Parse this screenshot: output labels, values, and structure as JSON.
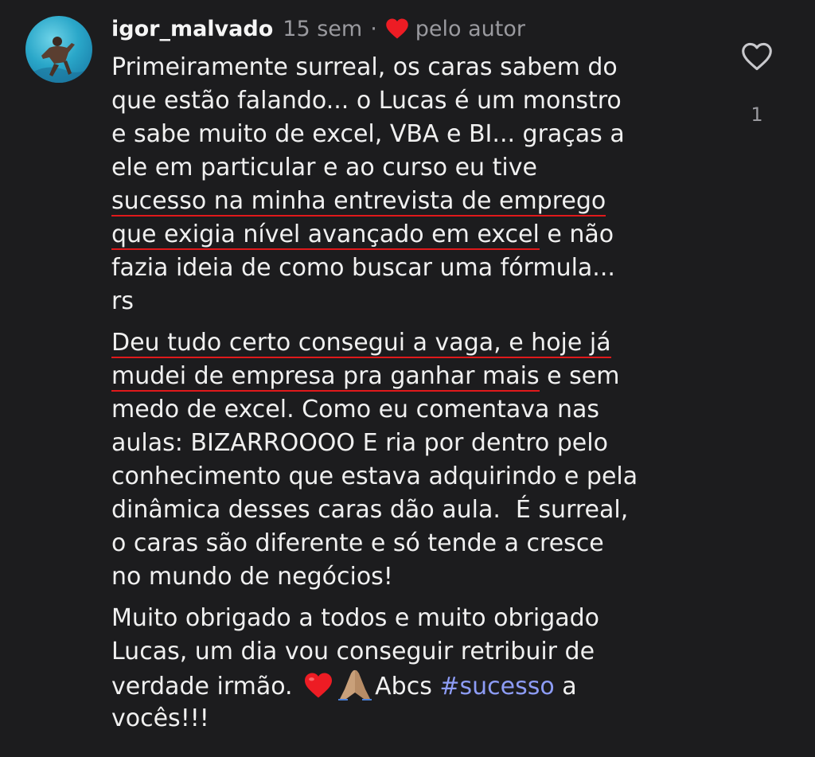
{
  "comment": {
    "username": "igor_malvado",
    "time": "15 sem",
    "separator": "·",
    "author_like_label": "pelo autor",
    "like_count": "1",
    "lines": {
      "l1": "Primeiramente surreal, os caras sabem do",
      "l2": "que estão falando... o Lucas é um monstro",
      "l3": "e sabe muito de excel, VBA e BI... graças a",
      "l4": "ele em particular e ao curso eu tive",
      "l5": "sucesso na minha entrevista de emprego",
      "l6a": "que exigia nível avançado em excel",
      "l6b": " e não",
      "l7": "fazia ideia de como buscar uma fórmula...",
      "l8": "rs",
      "l9": "Deu tudo certo consegui a vaga, e hoje já",
      "l10a": "mudei de empresa pra ganhar mais",
      "l10b": " e sem",
      "l11": "medo de excel. Como eu comentava nas",
      "l12": "aulas: BIZARROOOO E ria por dentro pelo",
      "l13": "conhecimento que estava adquirindo e pela",
      "l14": "dinâmica desses caras dão aula.  É surreal,",
      "l15": "o caras são diferente e só tende a cresce",
      "l16": "no mundo de negócios!",
      "l17": "Muito obrigado a todos e muito obrigado",
      "l18": "Lucas, um dia vou conseguir retribuir de",
      "l19a": "verdade irmão. ",
      "l19b": "Abcs ",
      "l19c": "#sucesso",
      "l19d": " a",
      "l20": "vocês!!!"
    }
  },
  "colors": {
    "background": "#1c1c1e",
    "text": "#f0f0f0",
    "muted": "#9a9a9f",
    "underline": "#e0191b",
    "hashtag": "#8d9cf5",
    "heart": "#ed1c24"
  },
  "icons": {
    "author_heart": "red-heart-icon",
    "like": "heart-outline-icon",
    "emoji_1": "red-heart-emoji",
    "emoji_2": "folded-hands-emoji"
  }
}
